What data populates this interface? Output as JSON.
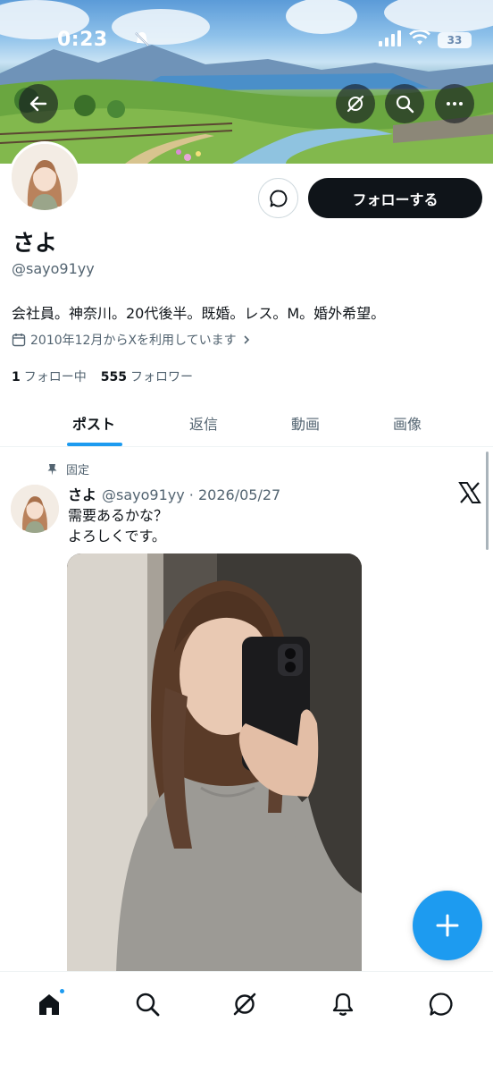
{
  "status_bar": {
    "time": "0:23",
    "battery": "33"
  },
  "profile": {
    "display_name": "さよ",
    "handle": "@sayo91yy",
    "bio": "会社員。神奈川。20代後半。既婚。レス。M。婚外希望。",
    "joined": "2010年12月からXを利用しています",
    "following_count": "1",
    "following_label": "フォロー中",
    "followers_count": "555",
    "followers_label": "フォロワー",
    "follow_button": "フォローする"
  },
  "tabs": [
    {
      "label": "ポスト",
      "active": true
    },
    {
      "label": "返信",
      "active": false
    },
    {
      "label": "動画",
      "active": false
    },
    {
      "label": "画像",
      "active": false
    }
  ],
  "post": {
    "pinned_label": "固定",
    "author": "さよ",
    "meta": "@sayo91yy · 2026/05/27",
    "text": "需要あるかな？\nよろしくです。"
  },
  "icons": {
    "back": "back-arrow-icon",
    "grok": "grok-icon",
    "search": "search-icon",
    "more": "more-icon",
    "message": "message-icon",
    "calendar": "calendar-icon",
    "pin": "pin-icon",
    "x": "x-logo-icon",
    "compose": "plus-icon",
    "nav": [
      "home-icon",
      "search-icon",
      "grok-icon",
      "bell-icon",
      "message-icon"
    ]
  },
  "colors": {
    "accent": "#1d9bf0",
    "text": "#0f1419",
    "secondary": "#536471",
    "follow_button": "#0f1419"
  }
}
